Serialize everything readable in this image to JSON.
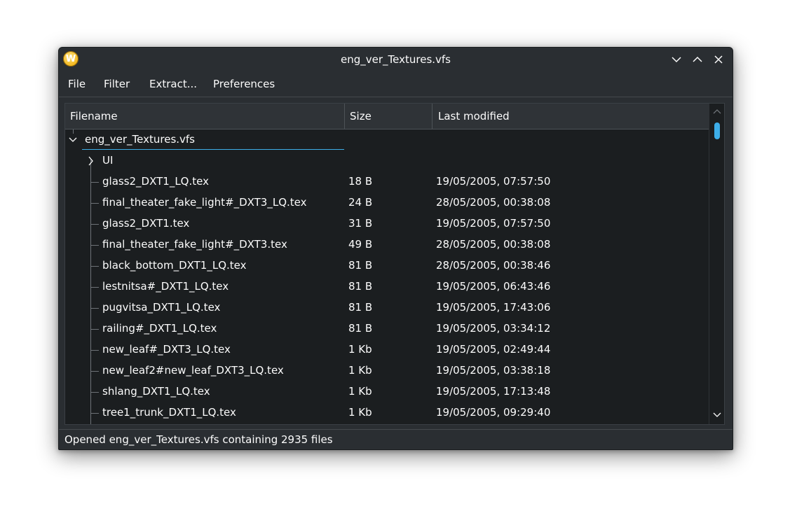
{
  "window": {
    "title": "eng_ver_Textures.vfs",
    "app_icon_letter": "W"
  },
  "menu": [
    "File",
    "Filter",
    "Extract...",
    "Preferences"
  ],
  "columns": [
    "Filename",
    "Size",
    "Last modified"
  ],
  "tree": {
    "root": "eng_ver_Textures.vfs",
    "folder": "UI",
    "files": [
      {
        "name": "glass2_DXT1_LQ.tex",
        "size": "18 B",
        "modified": "19/05/2005, 07:57:50"
      },
      {
        "name": "final_theater_fake_light#_DXT3_LQ.tex",
        "size": "24 B",
        "modified": "28/05/2005, 00:38:08"
      },
      {
        "name": "glass2_DXT1.tex",
        "size": "31 B",
        "modified": "19/05/2005, 07:57:50"
      },
      {
        "name": "final_theater_fake_light#_DXT3.tex",
        "size": "49 B",
        "modified": "28/05/2005, 00:38:08"
      },
      {
        "name": "black_bottom_DXT1_LQ.tex",
        "size": "81 B",
        "modified": "28/05/2005, 00:38:46"
      },
      {
        "name": "lestnitsa#_DXT1_LQ.tex",
        "size": "81 B",
        "modified": "19/05/2005, 06:43:46"
      },
      {
        "name": "pugvitsa_DXT1_LQ.tex",
        "size": "81 B",
        "modified": "19/05/2005, 17:43:06"
      },
      {
        "name": "railing#_DXT1_LQ.tex",
        "size": "81 B",
        "modified": "19/05/2005, 03:34:12"
      },
      {
        "name": "new_leaf#_DXT3_LQ.tex",
        "size": "1 Kb",
        "modified": "19/05/2005, 02:49:44"
      },
      {
        "name": "new_leaf2#new_leaf_DXT3_LQ.tex",
        "size": "1 Kb",
        "modified": "19/05/2005, 03:38:18"
      },
      {
        "name": "shlang_DXT1_LQ.tex",
        "size": "1 Kb",
        "modified": "19/05/2005, 17:13:48"
      },
      {
        "name": "tree1_trunk_DXT1_LQ.tex",
        "size": "1 Kb",
        "modified": "19/05/2005, 09:29:40"
      }
    ]
  },
  "status": "Opened eng_ver_Textures.vfs containing 2935 files",
  "colors": {
    "accent": "#3daee9",
    "window_bg": "#2a2e32",
    "view_bg": "#1b1e20",
    "text": "#fcfcfc"
  }
}
